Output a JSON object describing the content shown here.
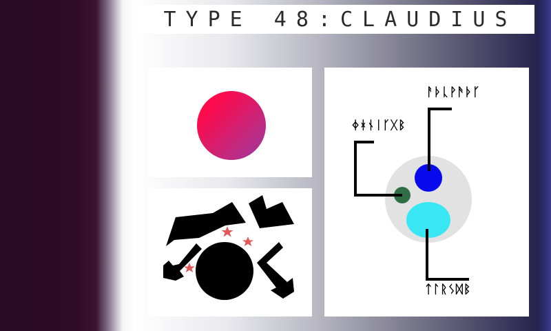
{
  "title": "TYPE 48:CLAUDIUS",
  "colors": {
    "left_band": "#2e0b27",
    "circle_gradient": [
      "#ff0a4a",
      "#9b3aa0"
    ],
    "star_color": "#e05858",
    "blue_orb": "#0a0aee",
    "cyan_orb": "#38e6f4",
    "green_orb": "#2f6e45",
    "base_disc": "#e2e2e2"
  },
  "diagram": {
    "labels": {
      "top": "ᚨᚦᚳᚹᚫᚦᚴ",
      "left": "ᛄᚼᚾᛁᚴᚷᛒ",
      "bottom": "ᛏᛚᚱᛊᛞᛒ"
    }
  },
  "icons": [
    "gradient-circle",
    "black-arrow-shapes",
    "red-star-icons",
    "black-circle",
    "orbital-diagram"
  ]
}
